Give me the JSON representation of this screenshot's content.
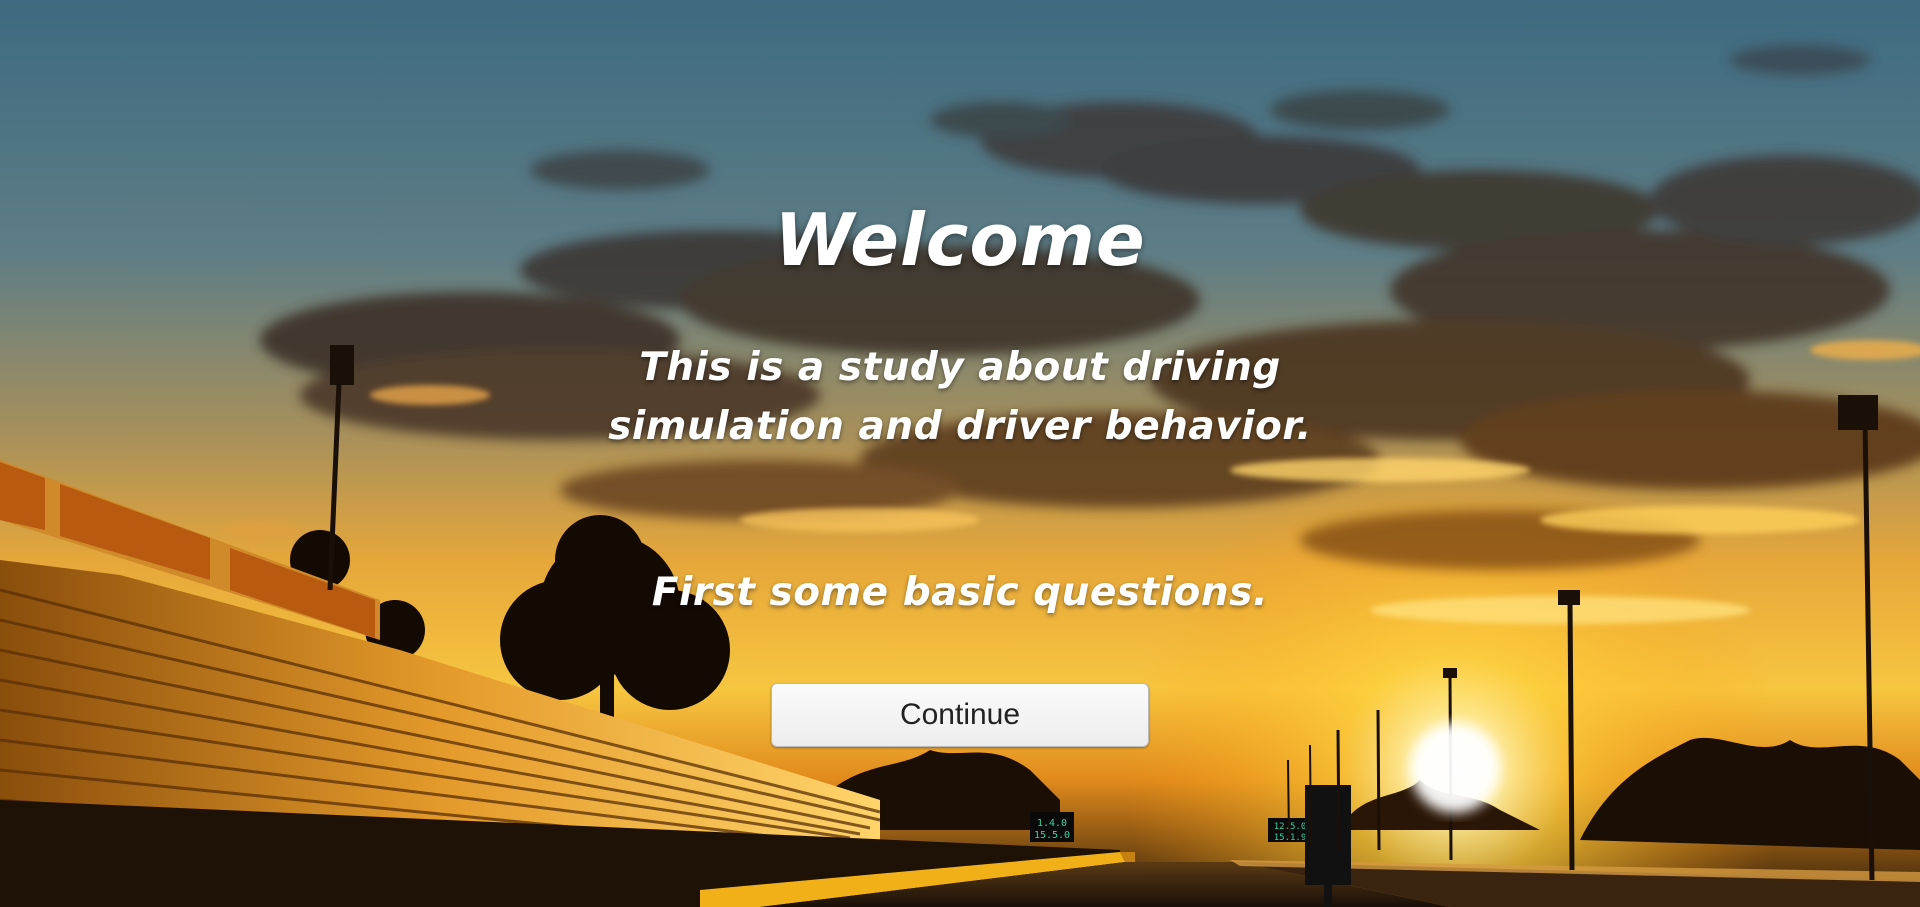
{
  "welcome": {
    "title": "Welcome",
    "subtitle_lines": [
      "This is a study about driving",
      "simulation and driver behavior."
    ],
    "prompt": "First some basic questions.",
    "continue_label": "Continue"
  },
  "background": {
    "scoreboard_left": [
      "1.4.0",
      "15.5.0"
    ],
    "scoreboard_right": [
      "12.5.0",
      "15.1.9"
    ]
  },
  "colors": {
    "sky_top": "#3f6a80",
    "sun_glow": "#ffd24a",
    "button_bg": "#f3f3f3",
    "text": "#ffffff"
  }
}
